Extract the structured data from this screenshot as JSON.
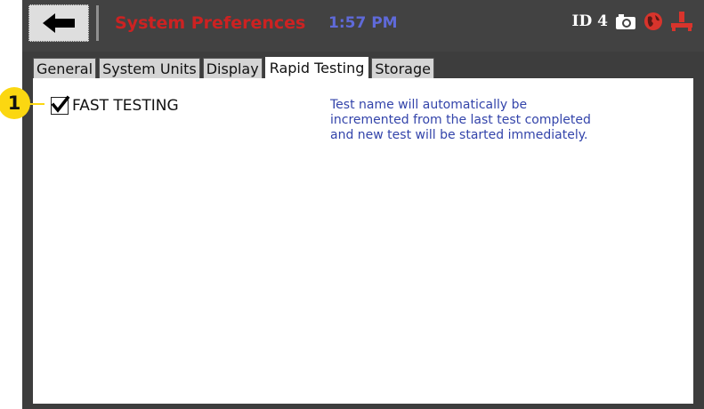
{
  "header": {
    "title": "System Preferences",
    "time": "1:57 PM",
    "id_label": "ID 4",
    "icons": [
      "back-arrow-icon",
      "camera-icon",
      "globe-icon",
      "network-icon"
    ]
  },
  "tabs": [
    {
      "label": "General",
      "active": false
    },
    {
      "label": "System Units",
      "active": false
    },
    {
      "label": "Display",
      "active": false
    },
    {
      "label": "Rapid Testing",
      "active": true
    },
    {
      "label": "Storage",
      "active": false
    }
  ],
  "rapid_testing": {
    "fast_testing_label": "FAST TESTING",
    "fast_testing_checked": true,
    "description": "Test name will automatically be incremented from the last test completed and new test will be started immediately."
  },
  "callout": {
    "number": "1"
  },
  "colors": {
    "title_red": "#cc2222",
    "time_blue": "#5f6ad9",
    "description_blue": "#3344aa",
    "callout_yellow": "#fbd711",
    "frame_dark": "#3d3d3d"
  }
}
